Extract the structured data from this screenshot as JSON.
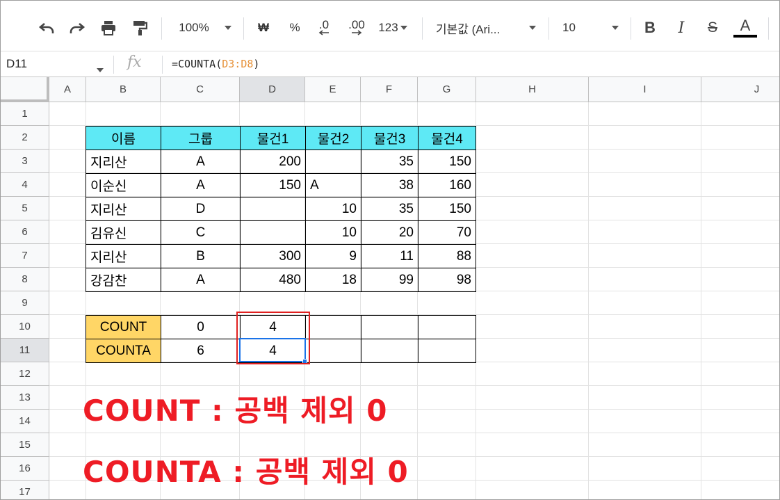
{
  "toolbar": {
    "zoom": "100%",
    "currency": "₩",
    "percent": "%",
    "decrease_decimal": ".0",
    "increase_decimal": ".00",
    "number_format": "123",
    "font_family": "기본값 (Ari...",
    "font_size": "10",
    "bold": "B",
    "italic": "I",
    "strikethrough": "S",
    "text_color": "A",
    "icons": [
      "undo-icon",
      "redo-icon",
      "print-icon",
      "paint-format-icon"
    ]
  },
  "formula_bar": {
    "cell_ref": "D11",
    "fx": "fx",
    "formula_prefix": "=COUNTA(",
    "formula_range": "D3:D8",
    "formula_suffix": ")"
  },
  "columns": [
    "A",
    "B",
    "C",
    "D",
    "E",
    "F",
    "G",
    "H",
    "I",
    "J"
  ],
  "rows": [
    "1",
    "2",
    "3",
    "4",
    "5",
    "6",
    "7",
    "8",
    "9",
    "10",
    "11",
    "12",
    "13",
    "14",
    "15",
    "16",
    "17"
  ],
  "table": {
    "headers": [
      "이름",
      "그룹",
      "물건1",
      "물건2",
      "물건3",
      "물건4"
    ],
    "rows": [
      [
        "지리산",
        "A",
        "200",
        "",
        "35",
        "150"
      ],
      [
        "이순신",
        "A",
        "150",
        "A",
        "38",
        "160"
      ],
      [
        "지리산",
        "D",
        "",
        "10",
        "35",
        "150"
      ],
      [
        "김유신",
        "C",
        "",
        "10",
        "20",
        "70"
      ],
      [
        "지리산",
        "B",
        "300",
        "9",
        "11",
        "88"
      ],
      [
        "강감찬",
        "A",
        "480",
        "18",
        "99",
        "98"
      ]
    ]
  },
  "summary": {
    "count_label": "COUNT",
    "count_c": "0",
    "count_d": "4",
    "counta_label": "COUNTA",
    "counta_c": "6",
    "counta_d": "4"
  },
  "notes": {
    "line1": "COUNT : 공백 제외 0",
    "line2": "COUNTA : 공백 제외 0"
  },
  "colors": {
    "header_fill": "#5ee9f5",
    "label_fill": "#ffd666",
    "annotation_red": "#ee1c25",
    "selection_blue": "#1a73e8"
  }
}
